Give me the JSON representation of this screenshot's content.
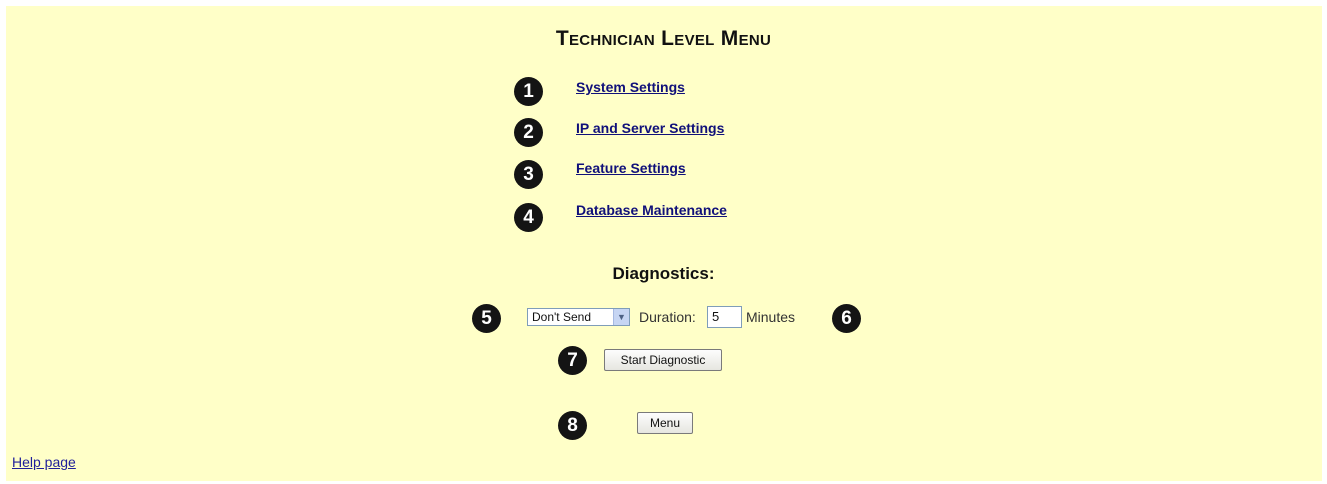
{
  "page": {
    "title": "Technician Level Menu",
    "background_color": "#ffffc8"
  },
  "menu": {
    "items": [
      {
        "number": "1",
        "label": "System Settings"
      },
      {
        "number": "2",
        "label": "IP and Server Settings"
      },
      {
        "number": "3",
        "label": "Feature Settings"
      },
      {
        "number": "4",
        "label": "Database Maintenance"
      }
    ]
  },
  "diagnostics": {
    "heading": "Diagnostics:",
    "send_select": {
      "selected": "Don't Send"
    },
    "duration_label": "Duration:",
    "duration_value": "5",
    "units_label": "Minutes",
    "start_button": "Start Diagnostic"
  },
  "footer": {
    "menu_button": "Menu",
    "help_link": "Help page"
  },
  "callouts": {
    "select": "5",
    "duration": "6",
    "start": "7",
    "menu": "8"
  }
}
